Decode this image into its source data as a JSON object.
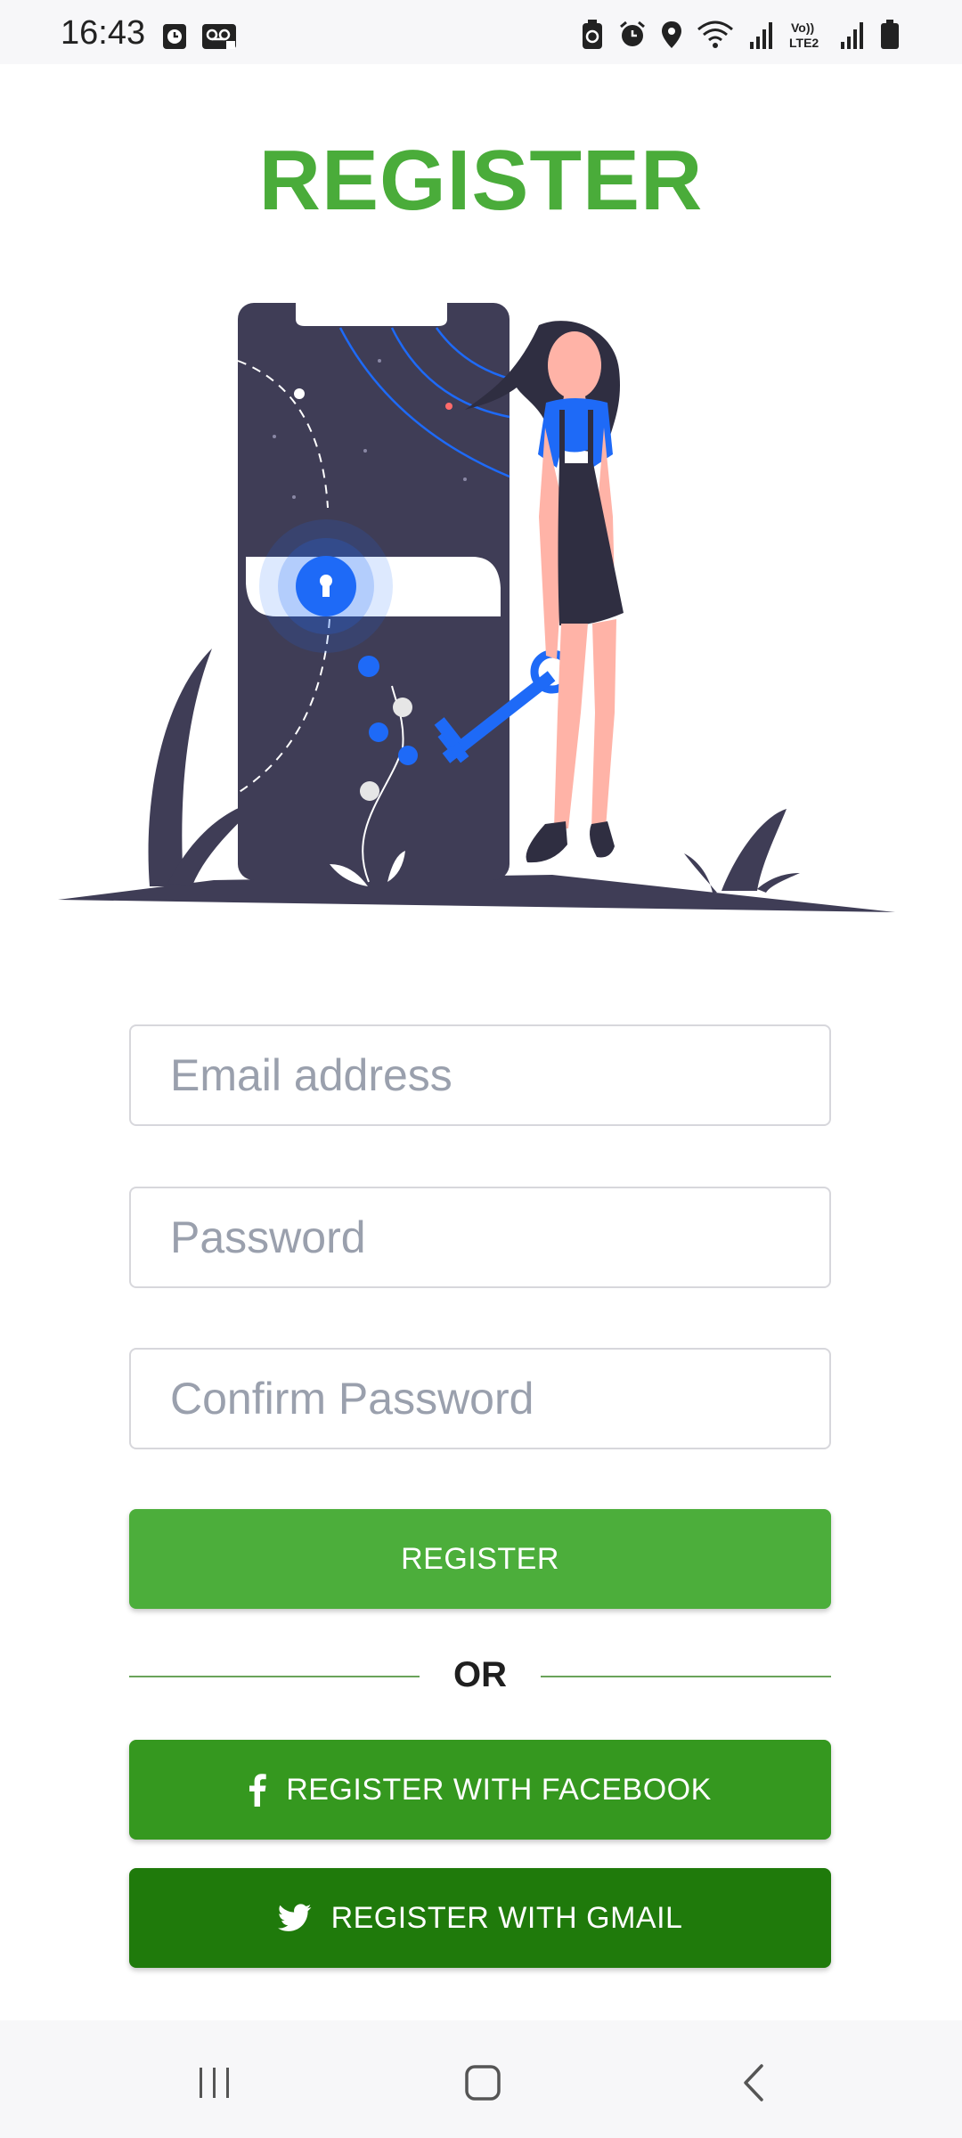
{
  "status_bar": {
    "time": "16:43",
    "left_icons": [
      "clock-badge-icon",
      "voicemail-icon"
    ],
    "right_icons": [
      "battery-saver-icon",
      "alarm-icon",
      "location-icon",
      "wifi-icon",
      "signal-icon",
      "volte-icon",
      "signal-icon",
      "battery-icon"
    ],
    "volte_label": "Vo) LTE2"
  },
  "page": {
    "title": "REGISTER",
    "title_color": "#4aac3a"
  },
  "illustration": {
    "icon": "phone-lock-key-illustration",
    "colors": {
      "dark": "#3f3d56",
      "accent": "#1e6af7",
      "skin": "#ffb3a7"
    }
  },
  "form": {
    "email_placeholder": "Email address",
    "password_placeholder": "Password",
    "confirm_placeholder": "Confirm Password",
    "email_value": "",
    "password_value": "",
    "confirm_value": ""
  },
  "buttons": {
    "register_label": "REGISTER",
    "register_color": "#4cae3b",
    "or_text": "OR",
    "facebook_label": "REGISTER WITH FACEBOOK",
    "facebook_icon": "facebook-icon",
    "facebook_color": "#35981f",
    "gmail_label": "REGISTER WITH GMAIL",
    "gmail_icon": "twitter-icon",
    "gmail_color": "#1f7a0b"
  },
  "nav_bar": {
    "items": [
      "recent-apps-icon",
      "home-icon",
      "back-icon"
    ]
  }
}
